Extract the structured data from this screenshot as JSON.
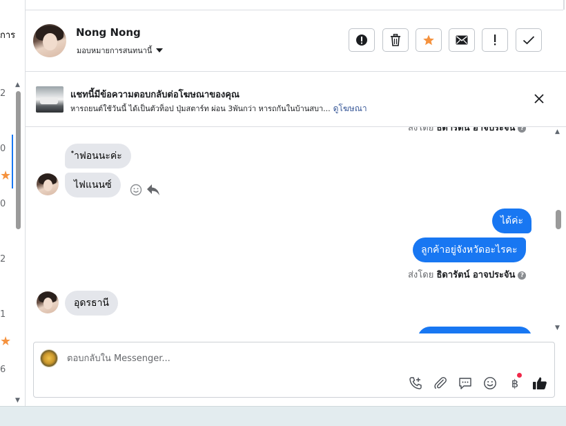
{
  "left_rail": {
    "partial_text": "การ",
    "numbers": [
      "2",
      "0",
      "0",
      "2",
      "1",
      "6"
    ]
  },
  "header": {
    "contact_name": "Nong Nong",
    "assign_label": "มอบหมายการสนทนานี้",
    "actions": [
      {
        "icon": "alert-circle-icon"
      },
      {
        "icon": "trash-icon"
      },
      {
        "icon": "star-icon"
      },
      {
        "icon": "mail-icon"
      },
      {
        "icon": "exclamation-icon"
      },
      {
        "icon": "check-icon"
      }
    ]
  },
  "ad_banner": {
    "title": "แชทนี้มีข้อความตอบกลับต่อโฆษณาของคุณ",
    "subtitle": "หารถยนต์ใช้วันนี้ ได้เป็นตัวท็อป ปุ่มสตาร์ท ผ่อน 3พันกว่า หารถกันในบ้านสบา...",
    "link_label": "ดูโฆษณา"
  },
  "messages": {
    "sent_by_prefix": "ส่งโดย",
    "agent_name": "ธิดารัตน์ อาจประจัน",
    "in_1": "ำฟอนนะค่ะ",
    "in_2": "ไฟแนนซ์",
    "out_1": "ได้ค่ะ",
    "out_2": "ลูกค้าอยู่จังหวัดอะไรคะ",
    "in_3": "อุดรธานี"
  },
  "composer": {
    "placeholder": "ตอบกลับใน Messenger...",
    "baht_symbol": "฿"
  },
  "colors": {
    "accent": "#1877f2",
    "star": "#f5923e",
    "incoming_bubble": "#e4e6eb",
    "notification": "#f02849"
  }
}
